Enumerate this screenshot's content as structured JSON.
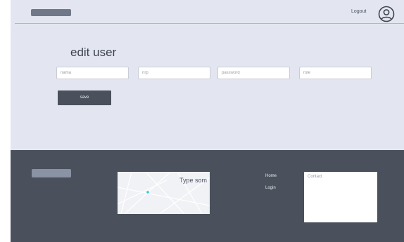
{
  "header": {
    "logout_label": "Logout",
    "avatar_icon": "user-circle-icon"
  },
  "form": {
    "title": "edit user",
    "fields": [
      {
        "placeholder": "nama",
        "value": ""
      },
      {
        "placeholder": "nrp",
        "value": ""
      },
      {
        "placeholder": "password",
        "value": ""
      },
      {
        "placeholder": "role",
        "value": ""
      }
    ],
    "save_label": "save"
  },
  "footer": {
    "map": {
      "input_text": "Type som",
      "marker_icon": "map-pin-icon"
    },
    "nav": [
      {
        "label": "Home"
      },
      {
        "label": "Login"
      }
    ],
    "contact": {
      "placeholder": "Contact"
    }
  },
  "colors": {
    "page_bg": "#e3e6f0",
    "footer_bg": "#4a515c",
    "button_bg": "#4a505c",
    "header_rule": "#b3b0e6",
    "map_marker": "#3cc7d9"
  }
}
